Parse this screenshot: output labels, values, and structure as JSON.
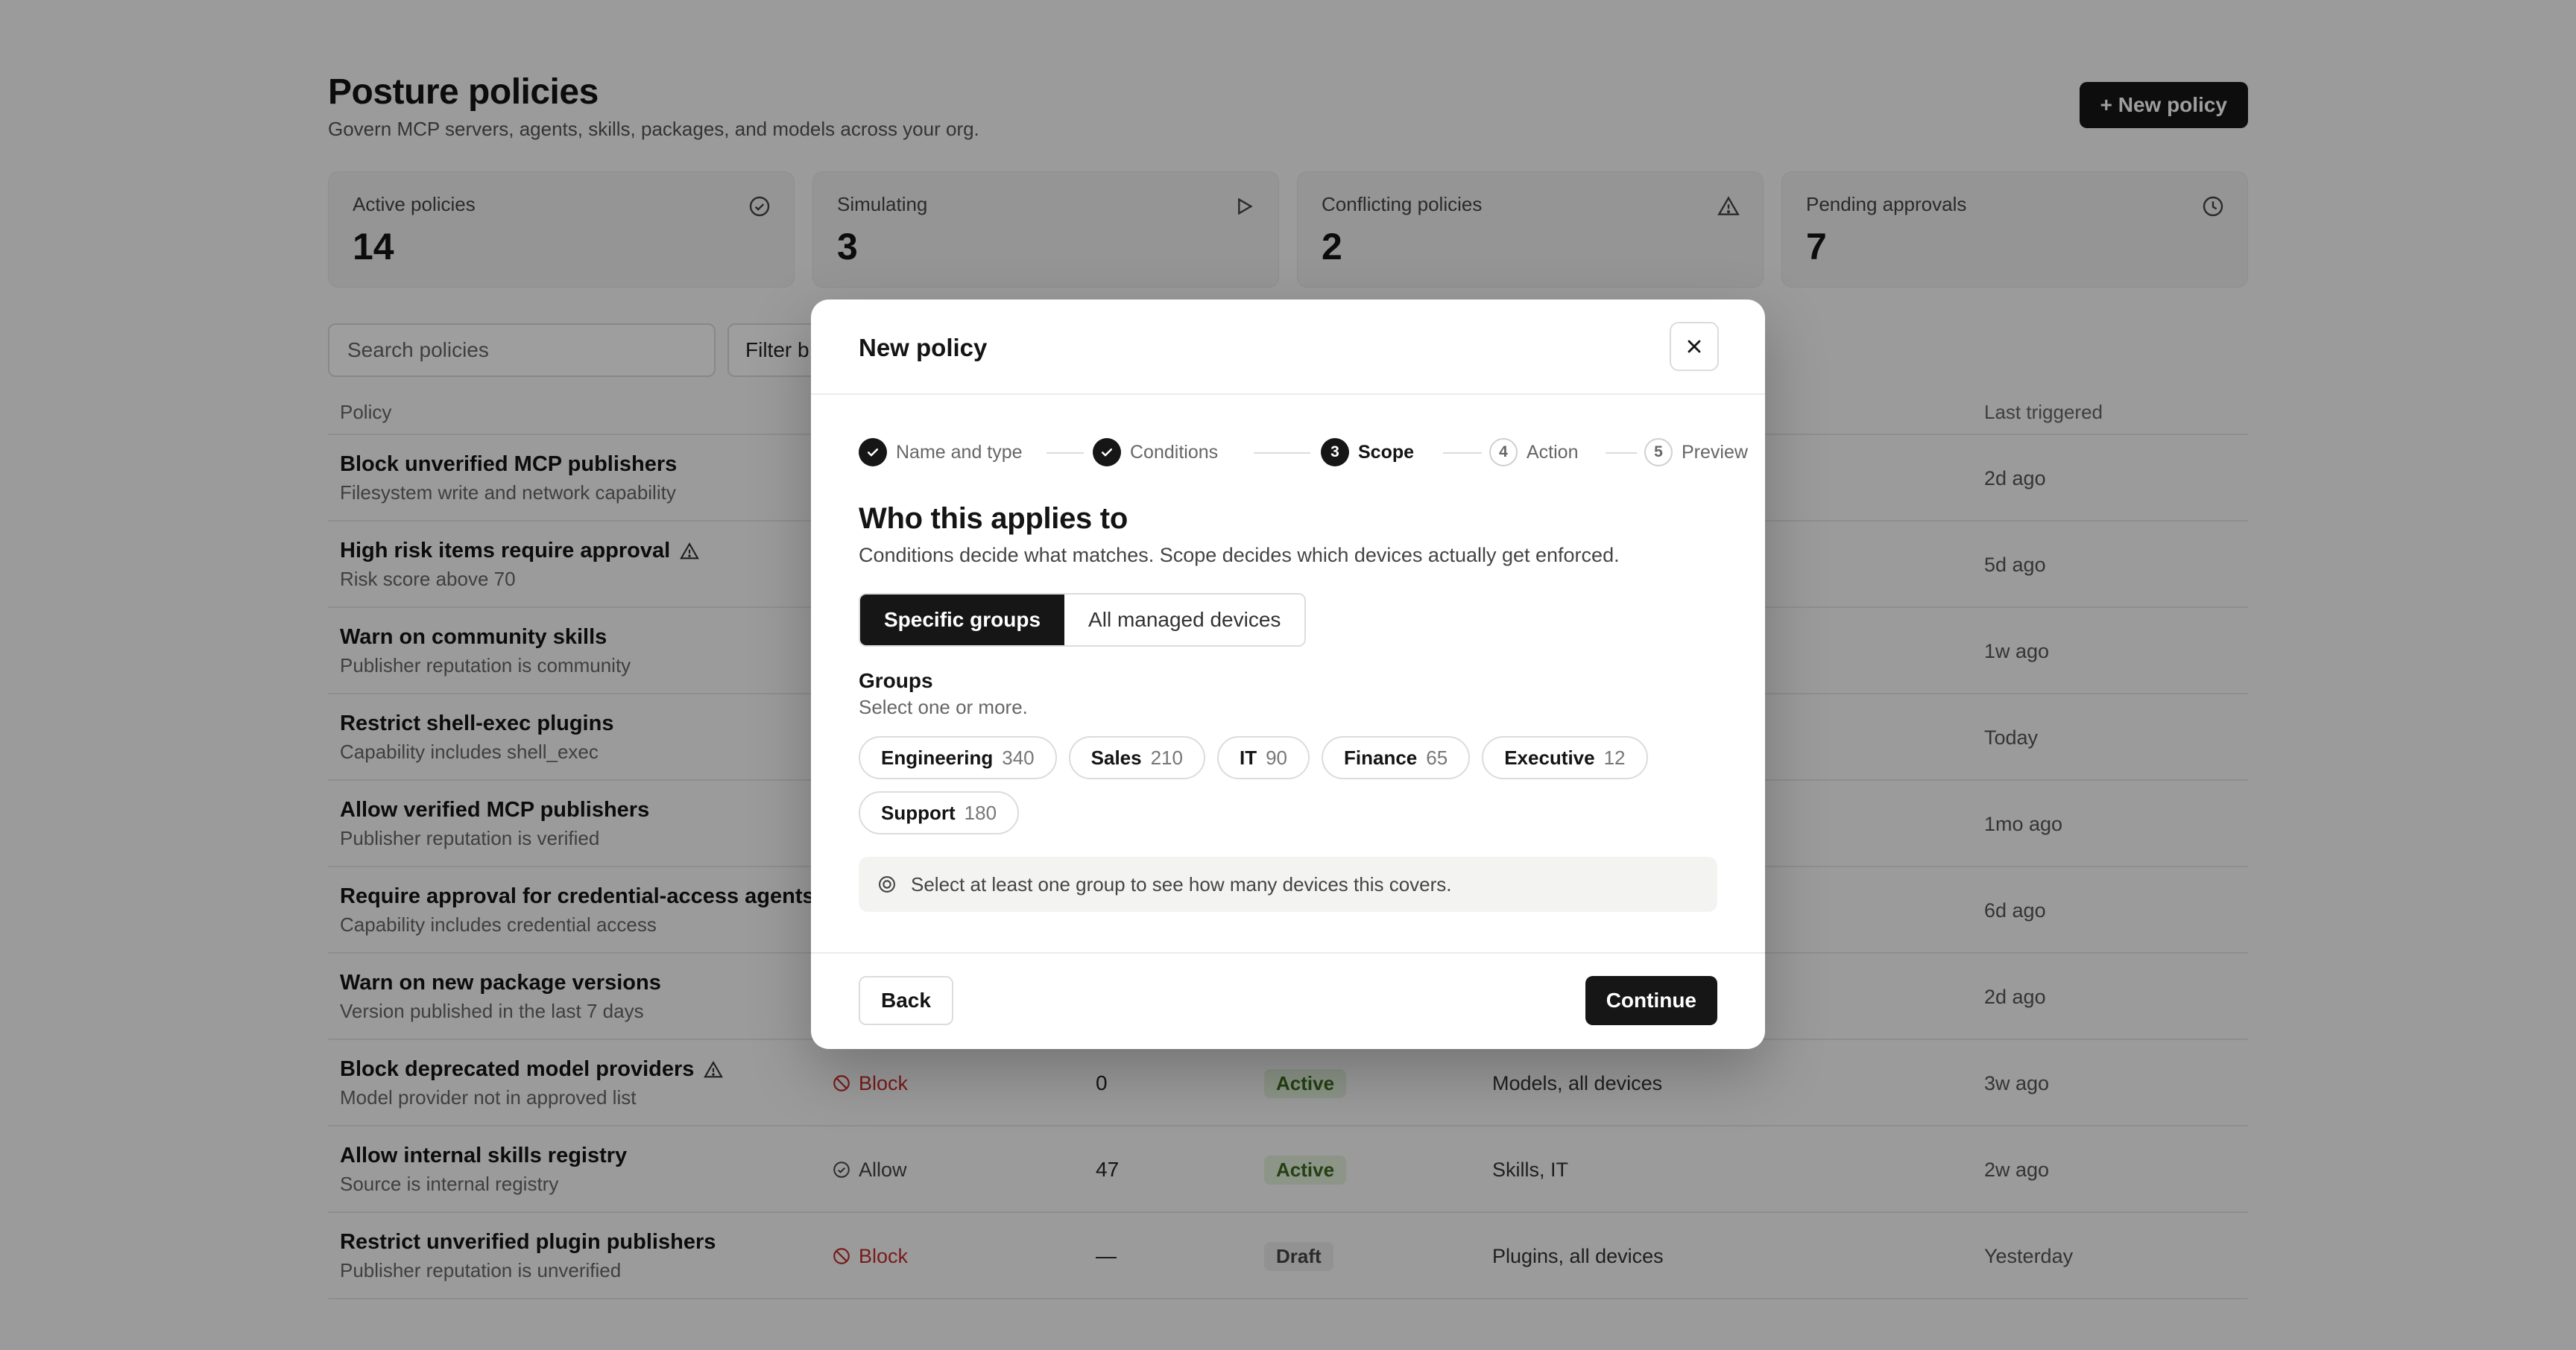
{
  "header": {
    "title": "Posture policies",
    "subtitle": "Govern MCP servers, agents, skills, packages, and models across your org.",
    "new_policy_label": "+ New policy"
  },
  "stats": [
    {
      "label": "Active policies",
      "value": "14",
      "icon": "check-circle-icon"
    },
    {
      "label": "Simulating",
      "value": "3",
      "icon": "play-icon"
    },
    {
      "label": "Conflicting policies",
      "value": "2",
      "icon": "warning-icon"
    },
    {
      "label": "Pending approvals",
      "value": "7",
      "icon": "clock-icon"
    }
  ],
  "toolbar": {
    "search_placeholder": "Search policies",
    "filter_label": "Filter b"
  },
  "table": {
    "columns": {
      "policy": "Policy",
      "last_triggered": "Last triggered"
    },
    "rows": [
      {
        "name": "Block unverified MCP publishers",
        "desc": "Filesystem write and network capability",
        "last": "2d ago"
      },
      {
        "name": "High risk items require approval",
        "desc": "Risk score above 70",
        "last": "5d ago"
      },
      {
        "name": "Warn on community skills",
        "desc": "Publisher reputation is community",
        "last": "1w ago"
      },
      {
        "name": "Restrict shell-exec plugins",
        "desc": "Capability includes shell_exec",
        "last": "Today"
      },
      {
        "name": "Allow verified MCP publishers",
        "desc": "Publisher reputation is verified",
        "last": "1mo ago"
      },
      {
        "name": "Require approval for credential-access agents",
        "desc": "Capability includes credential access",
        "last": "6d ago"
      },
      {
        "name": "Warn on new package versions",
        "desc": "Version published in the last 7 days",
        "last": "2d ago"
      },
      {
        "name": "Block deprecated model providers",
        "desc": "Model provider not in approved list",
        "action": "Block",
        "matches": "0",
        "status": "Active",
        "scope": "Models, all devices",
        "last": "3w ago"
      },
      {
        "name": "Allow internal skills registry",
        "desc": "Source is internal registry",
        "action": "Allow",
        "matches": "47",
        "status": "Active",
        "scope": "Skills, IT",
        "last": "2w ago"
      },
      {
        "name": "Restrict unverified plugin publishers",
        "desc": "Publisher reputation is unverified",
        "action": "Block",
        "matches": "—",
        "status": "Draft",
        "scope": "Plugins, all devices",
        "last": "Yesterday"
      }
    ]
  },
  "modal": {
    "title": "New policy",
    "steps": [
      {
        "num": "1",
        "label": "Name and type",
        "state": "done"
      },
      {
        "num": "2",
        "label": "Conditions",
        "state": "done"
      },
      {
        "num": "3",
        "label": "Scope",
        "state": "current"
      },
      {
        "num": "4",
        "label": "Action",
        "state": "todo"
      },
      {
        "num": "5",
        "label": "Preview",
        "state": "todo"
      }
    ],
    "section_title": "Who this applies to",
    "section_sub": "Conditions decide what matches. Scope decides which devices actually get enforced.",
    "scope_options": {
      "specific": "Specific groups",
      "all": "All managed devices"
    },
    "groups_label": "Groups",
    "groups_sub": "Select one or more.",
    "groups": [
      {
        "name": "Engineering",
        "count": "340"
      },
      {
        "name": "Sales",
        "count": "210"
      },
      {
        "name": "IT",
        "count": "90"
      },
      {
        "name": "Finance",
        "count": "65"
      },
      {
        "name": "Executive",
        "count": "12"
      },
      {
        "name": "Support",
        "count": "180"
      }
    ],
    "info": "Select at least one group to see how many devices this covers.",
    "back_label": "Back",
    "continue_label": "Continue"
  },
  "colors": {
    "accent": "#161616",
    "block": "#c22d2d",
    "active_bg": "#e3f0dc",
    "active_fg": "#3b6a1f"
  }
}
